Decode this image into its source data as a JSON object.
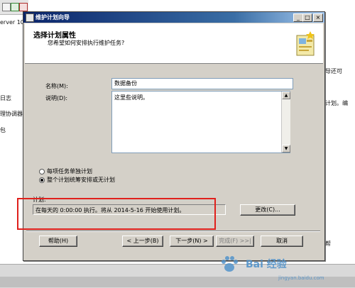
{
  "background": {
    "left_lines": [
      "erver 10.",
      "日志",
      "理协调器",
      "包"
    ],
    "right_lines": [
      "导还可",
      "计划。编",
      "帮"
    ]
  },
  "dialog": {
    "title": "维护计划向导",
    "header_title": "选择计划属性",
    "header_subtitle": "您希望如何安排执行维护任务?",
    "name_label": "名称(M):",
    "name_value": "数据备份",
    "desc_label": "说明(D):",
    "desc_value": "这里些说明。",
    "radio_options": [
      {
        "label": "每项任务单独计划",
        "selected": false
      },
      {
        "label": "整个计划统筹安排或无计划",
        "selected": true
      }
    ],
    "schedule_label": "计划:",
    "schedule_value": "在每天的 0:00:00 执行。将从 2014-5-16 开始使用计划。",
    "buttons": {
      "change": "更改(C)...",
      "help": "帮助(H)",
      "back": "< 上一步(B)",
      "next": "下一步(N) >",
      "finish": "完成(F) >>|",
      "cancel": "取消"
    },
    "window_controls": {
      "min": "_",
      "max": "□",
      "close": "×"
    }
  },
  "watermark": {
    "text": "Bai 经验",
    "url": "jingyan.baidu.com"
  },
  "colors": {
    "highlight": "#e0201c",
    "titlebar": "#0a246a",
    "dialog_bg": "#d4d0c8"
  }
}
